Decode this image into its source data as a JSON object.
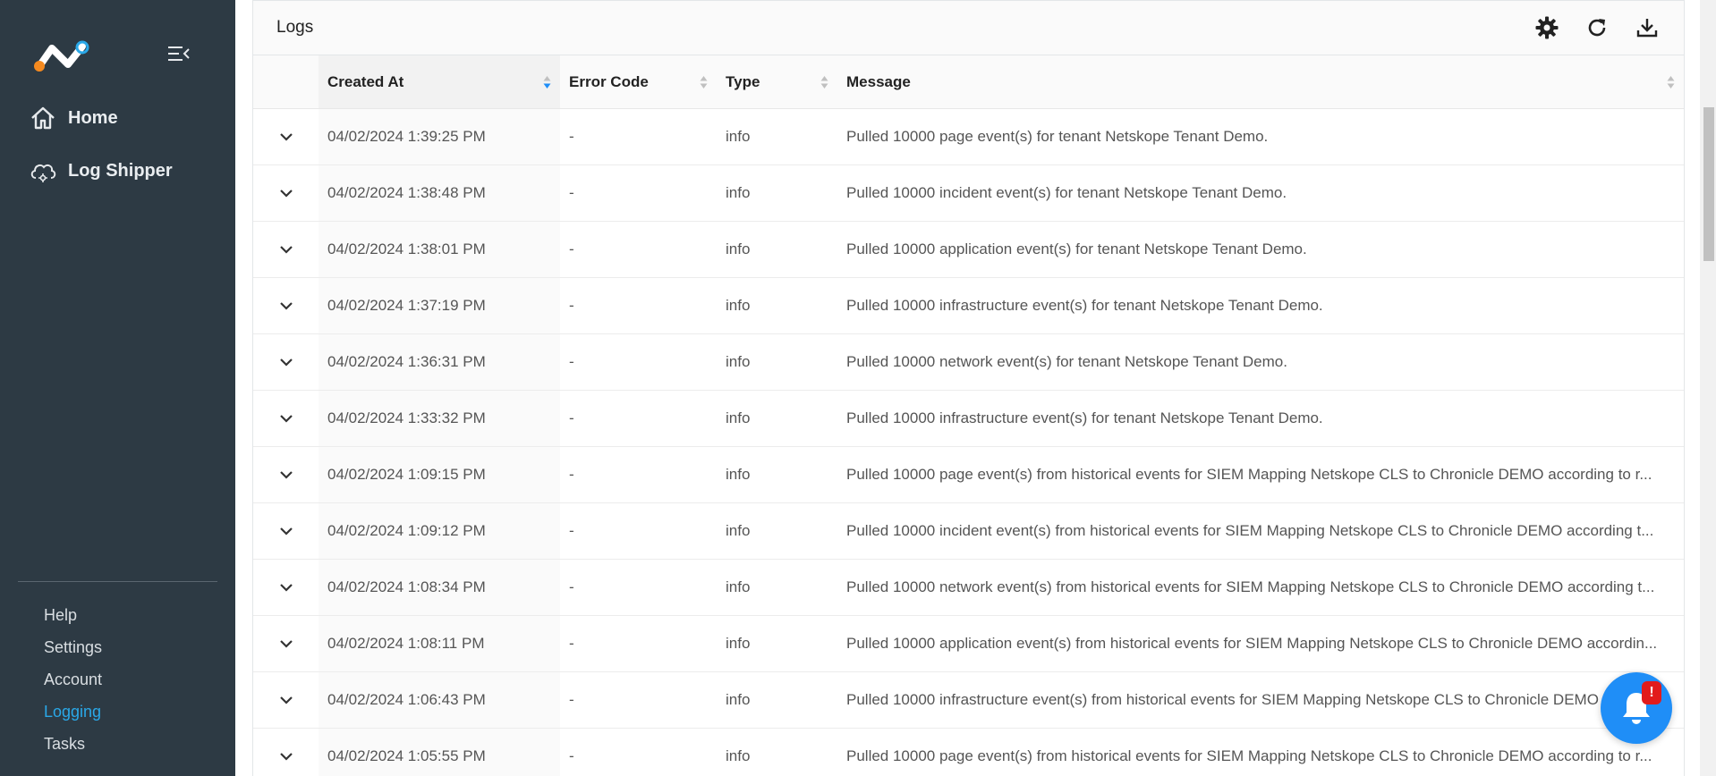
{
  "sidebar": {
    "nav": [
      {
        "label": "Home",
        "icon": "home-icon"
      },
      {
        "label": "Log Shipper",
        "icon": "cloud-icon"
      }
    ],
    "bottom": [
      {
        "label": "Help"
      },
      {
        "label": "Settings"
      },
      {
        "label": "Account"
      },
      {
        "label": "Logging"
      },
      {
        "label": "Tasks"
      }
    ],
    "active_color": "#2aa8e8"
  },
  "panel": {
    "title": "Logs",
    "tools": [
      "gear-icon",
      "refresh-icon",
      "download-icon"
    ]
  },
  "table": {
    "columns": [
      "Created At",
      "Error Code",
      "Type",
      "Message"
    ],
    "rows": [
      {
        "created": "04/02/2024 1:39:25 PM",
        "code": "-",
        "type": "info",
        "message": "Pulled 10000 page event(s) for tenant Netskope Tenant Demo."
      },
      {
        "created": "04/02/2024 1:38:48 PM",
        "code": "-",
        "type": "info",
        "message": "Pulled 10000 incident event(s) for tenant Netskope Tenant Demo."
      },
      {
        "created": "04/02/2024 1:38:01 PM",
        "code": "-",
        "type": "info",
        "message": "Pulled 10000 application event(s) for tenant Netskope Tenant Demo."
      },
      {
        "created": "04/02/2024 1:37:19 PM",
        "code": "-",
        "type": "info",
        "message": "Pulled 10000 infrastructure event(s) for tenant Netskope Tenant Demo."
      },
      {
        "created": "04/02/2024 1:36:31 PM",
        "code": "-",
        "type": "info",
        "message": "Pulled 10000 network event(s) for tenant Netskope Tenant Demo."
      },
      {
        "created": "04/02/2024 1:33:32 PM",
        "code": "-",
        "type": "info",
        "message": "Pulled 10000 infrastructure event(s) for tenant Netskope Tenant Demo."
      },
      {
        "created": "04/02/2024 1:09:15 PM",
        "code": "-",
        "type": "info",
        "message": "Pulled 10000 page event(s) from historical events for SIEM Mapping Netskope CLS to Chronicle DEMO according to r..."
      },
      {
        "created": "04/02/2024 1:09:12 PM",
        "code": "-",
        "type": "info",
        "message": "Pulled 10000 incident event(s) from historical events for SIEM Mapping Netskope CLS to Chronicle DEMO according t..."
      },
      {
        "created": "04/02/2024 1:08:34 PM",
        "code": "-",
        "type": "info",
        "message": "Pulled 10000 network event(s) from historical events for SIEM Mapping Netskope CLS to Chronicle DEMO according t..."
      },
      {
        "created": "04/02/2024 1:08:11 PM",
        "code": "-",
        "type": "info",
        "message": "Pulled 10000 application event(s) from historical events for SIEM Mapping Netskope CLS to Chronicle DEMO accordin..."
      },
      {
        "created": "04/02/2024 1:06:43 PM",
        "code": "-",
        "type": "info",
        "message": "Pulled 10000 infrastructure event(s) from historical events for SIEM Mapping Netskope CLS to Chronicle DEMO"
      },
      {
        "created": "04/02/2024 1:05:55 PM",
        "code": "-",
        "type": "info",
        "message": "Pulled 10000 page event(s) from historical events for SIEM Mapping Netskope CLS to Chronicle DEMO according to r..."
      }
    ]
  },
  "notification": {
    "badge": "!",
    "icon": "bell-icon",
    "color": "#1f8ef7"
  }
}
